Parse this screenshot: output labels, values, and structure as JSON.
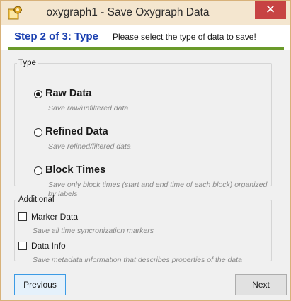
{
  "window": {
    "title": "oxygraph1 - Save Oxygraph Data",
    "close_glyph": "✕",
    "app_icon": "settings-gear-icon"
  },
  "header": {
    "step_title": "Step 2 of 3: Type",
    "step_description": "Please select the type of data to save!",
    "accent_color": "#6a9a2a",
    "step_title_color": "#1a3fb0"
  },
  "type_group": {
    "legend": "Type",
    "options": [
      {
        "label": "Raw Data",
        "description": "Save raw/unfiltered data",
        "selected": true
      },
      {
        "label": "Refined Data",
        "description": "Save refined/filtered data",
        "selected": false
      },
      {
        "label": "Block Times",
        "description": "Save only block times (start and end time of each block) organized by labels",
        "selected": false
      }
    ]
  },
  "additional_group": {
    "legend": "Additional",
    "options": [
      {
        "label": "Marker Data",
        "description": "Save all time syncronization markers",
        "checked": false
      },
      {
        "label": "Data Info",
        "description": "Save metadata information that describes properties of the data",
        "checked": false
      }
    ]
  },
  "buttons": {
    "previous": "Previous",
    "next": "Next"
  }
}
